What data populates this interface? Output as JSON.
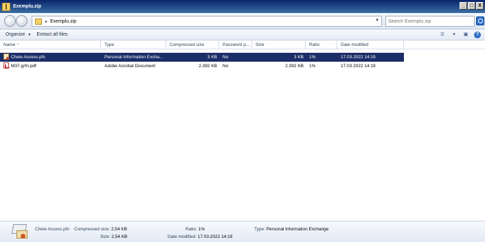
{
  "window": {
    "title": "Exemplu.zip",
    "controls": [
      "_",
      "□",
      "X"
    ]
  },
  "address": {
    "breadcrumb": "Exemplu.zip",
    "search_placeholder": "Search Exemplu.zip"
  },
  "commands": {
    "organize": "Organize",
    "extract_all": "Extract all files"
  },
  "columns": [
    "Name",
    "Type",
    "Compressed size",
    "Password p...",
    "Size",
    "Ratio",
    "Date modified"
  ],
  "files": [
    {
      "name": "Cheie Access.pfx",
      "type": "Personal Information Excha...",
      "compressed": "3 KB",
      "password": "No",
      "size": "3 KB",
      "ratio": "1%",
      "date": "17.03.2022 14:19",
      "icon": "pfx-icon",
      "selected": true
    },
    {
      "name": "M37-grfn.pdf",
      "type": "Adobe Acrobat Document",
      "compressed": "2.392 KB",
      "password": "No",
      "size": "2.392 KB",
      "ratio": "1%",
      "date": "17.03.2022 14:19",
      "icon": "pdf-icon",
      "selected": false
    }
  ],
  "details": {
    "name": "Cheie Access.pfx",
    "compressed_label": "Compressed size:",
    "compressed_value": "2,54 KB",
    "size_label": "Size:",
    "size_value": "2,54 KB",
    "ratio_label": "Ratio:",
    "ratio_value": "1%",
    "date_label": "Date modified:",
    "date_value": "17.03.2022 14:19",
    "type_label": "Type:",
    "type_value": "Personal Information Exchange"
  },
  "colors": {
    "selection": "#1c2e68",
    "titlebar": "#0a246a"
  }
}
